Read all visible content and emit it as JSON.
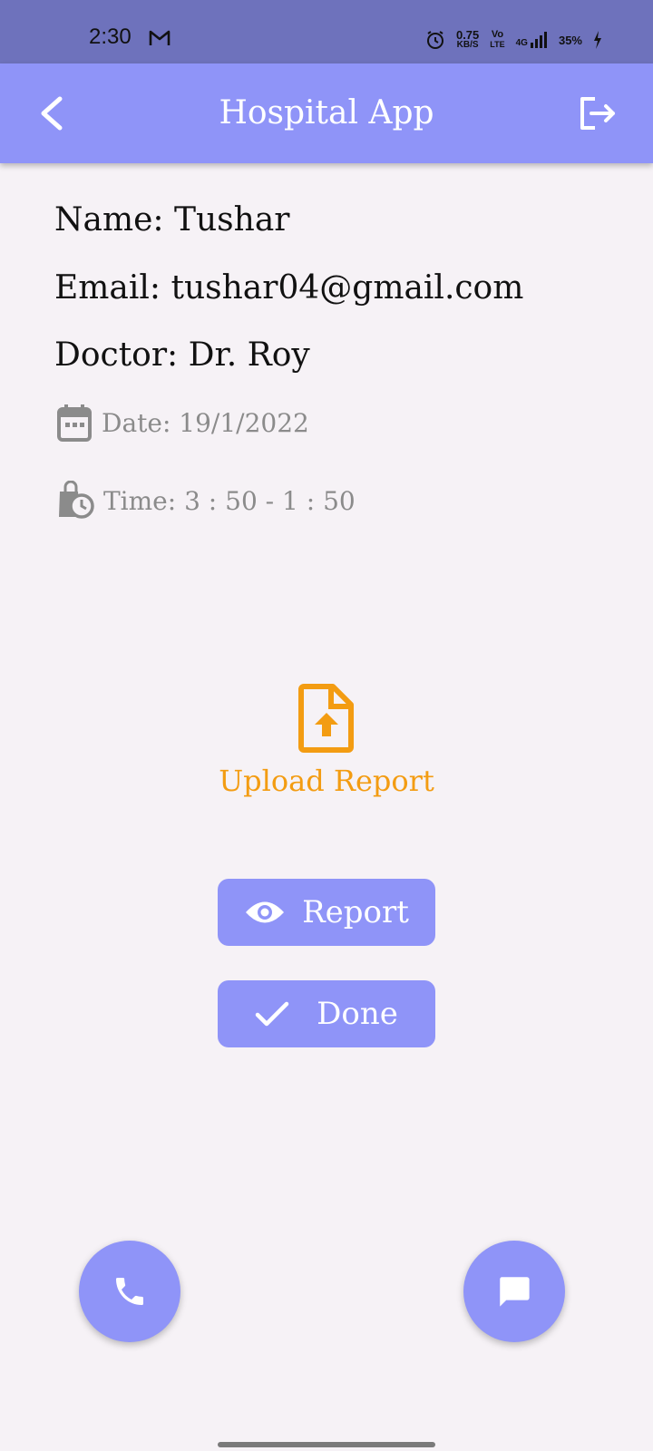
{
  "status_bar": {
    "time": "2:30",
    "speed_value": "0.75",
    "speed_unit": "KB/S",
    "volte_top": "Vo",
    "volte_bottom": "LTE",
    "network": "4G",
    "battery": "35%"
  },
  "app_bar": {
    "title": "Hospital App",
    "back_icon": "chevron-left-icon",
    "logout_icon": "logout-icon"
  },
  "appointment": {
    "name": "Name: Tushar",
    "email": "Email: tushar04@gmail.com",
    "doctor": "Doctor: Dr. Roy",
    "date": "Date: 19/1/2022",
    "time": "Time: 3 : 50 - 1 : 50"
  },
  "upload": {
    "label": "Upload Report",
    "color": "#f39c12"
  },
  "buttons": {
    "report": "Report",
    "done": "Done"
  },
  "fabs": {
    "call_icon": "phone-icon",
    "chat_icon": "chat-icon"
  },
  "colors": {
    "accent": "#8f94f8",
    "status_bar": "#6e72bc",
    "background": "#f6f2f6"
  }
}
